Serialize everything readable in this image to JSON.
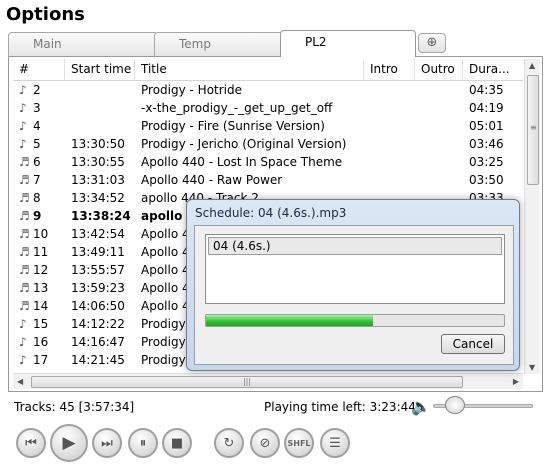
{
  "window": {
    "title": "Options"
  },
  "tabs": [
    {
      "label": "Main"
    },
    {
      "label": "Temp"
    },
    {
      "label": "PL2"
    }
  ],
  "columns": {
    "num": "#",
    "start": "Start time",
    "title": "Title",
    "intro": "Intro",
    "outro": "Outro",
    "duration": "Dura..."
  },
  "rows": [
    {
      "num": "2",
      "start": "",
      "title": "Prodigy - Hotride",
      "dur": "04:35",
      "icon": "music-note-icon"
    },
    {
      "num": "3",
      "start": "",
      "title": "-x-the_prodigy_-_get_up_get_off",
      "dur": "04:19",
      "icon": "music-note-icon"
    },
    {
      "num": "4",
      "start": "",
      "title": "Prodigy - Fire (Sunrise Version)",
      "dur": "05:01",
      "icon": "music-note-icon"
    },
    {
      "num": "5",
      "start": "13:30:50",
      "title": "Prodigy - Jericho (Original Version)",
      "dur": "03:46",
      "icon": "music-note-icon"
    },
    {
      "num": "6",
      "start": "13:30:55",
      "title": "Apollo 440 - Lost In Space Theme",
      "dur": "03:25",
      "icon": "scheduled-note-icon"
    },
    {
      "num": "7",
      "start": "13:31:03",
      "title": "Apollo 440 - Raw Power",
      "dur": "03:50",
      "icon": "scheduled-note-icon"
    },
    {
      "num": "8",
      "start": "13:34:52",
      "title": "apollo 440 - Track 2",
      "dur": "03:33",
      "icon": "scheduled-note-icon"
    },
    {
      "num": "9",
      "start": "13:38:24",
      "title": "apollo 440",
      "dur": "",
      "icon": "scheduled-note-icon",
      "bold": true
    },
    {
      "num": "10",
      "start": "13:42:54",
      "title": "Apollo 44",
      "dur": "",
      "icon": "scheduled-note-icon"
    },
    {
      "num": "11",
      "start": "13:49:11",
      "title": "Apollo 44",
      "dur": "",
      "icon": "scheduled-note-icon"
    },
    {
      "num": "12",
      "start": "13:55:57",
      "title": "Apollo 44",
      "dur": "",
      "icon": "scheduled-note-icon"
    },
    {
      "num": "13",
      "start": "13:59:23",
      "title": "Apollo 44",
      "dur": "",
      "icon": "scheduled-note-icon"
    },
    {
      "num": "14",
      "start": "14:06:50",
      "title": "Apollo 44",
      "dur": "",
      "icon": "scheduled-note-icon"
    },
    {
      "num": "15",
      "start": "14:12:22",
      "title": "Prodigy",
      "dur": "",
      "icon": "music-note-icon"
    },
    {
      "num": "16",
      "start": "14:16:47",
      "title": "Prodigy",
      "dur": "",
      "icon": "music-note-icon"
    },
    {
      "num": "17",
      "start": "14:21:45",
      "title": "Prodigy",
      "dur": "",
      "icon": "music-note-icon"
    }
  ],
  "status": {
    "tracks": "Tracks: 45 [3:57:34]",
    "time_left": "Playing time left: 3:23:44"
  },
  "volume_level": 0.12,
  "dialog": {
    "title": "Schedule: 04 (4.6s.).mp3",
    "item": "04 (4.6s.)",
    "progress": 0.56,
    "cancel_label": "Cancel"
  },
  "player_buttons": [
    {
      "name": "previous-button",
      "icon": "skip-back-icon",
      "glyph": "⏮"
    },
    {
      "name": "play-button",
      "icon": "play-icon",
      "glyph": "▶"
    },
    {
      "name": "next-button",
      "icon": "skip-forward-icon",
      "glyph": "⏭"
    },
    {
      "name": "pause-button",
      "icon": "pause-icon",
      "glyph": "⏸"
    },
    {
      "name": "stop-button",
      "icon": "stop-icon",
      "glyph": "■"
    },
    {
      "name": "repeat-button",
      "icon": "repeat-icon",
      "glyph": "↻"
    },
    {
      "name": "disable-button",
      "icon": "no-entry-icon",
      "glyph": "⊘"
    },
    {
      "name": "shuffle-button",
      "icon": "shuffle-icon",
      "glyph": "SHFL"
    },
    {
      "name": "playlist-button",
      "icon": "playlist-icon",
      "glyph": "☰"
    }
  ],
  "colors": {
    "progress": "#2ec22e",
    "dialog_frame": "#c6d7ea"
  }
}
